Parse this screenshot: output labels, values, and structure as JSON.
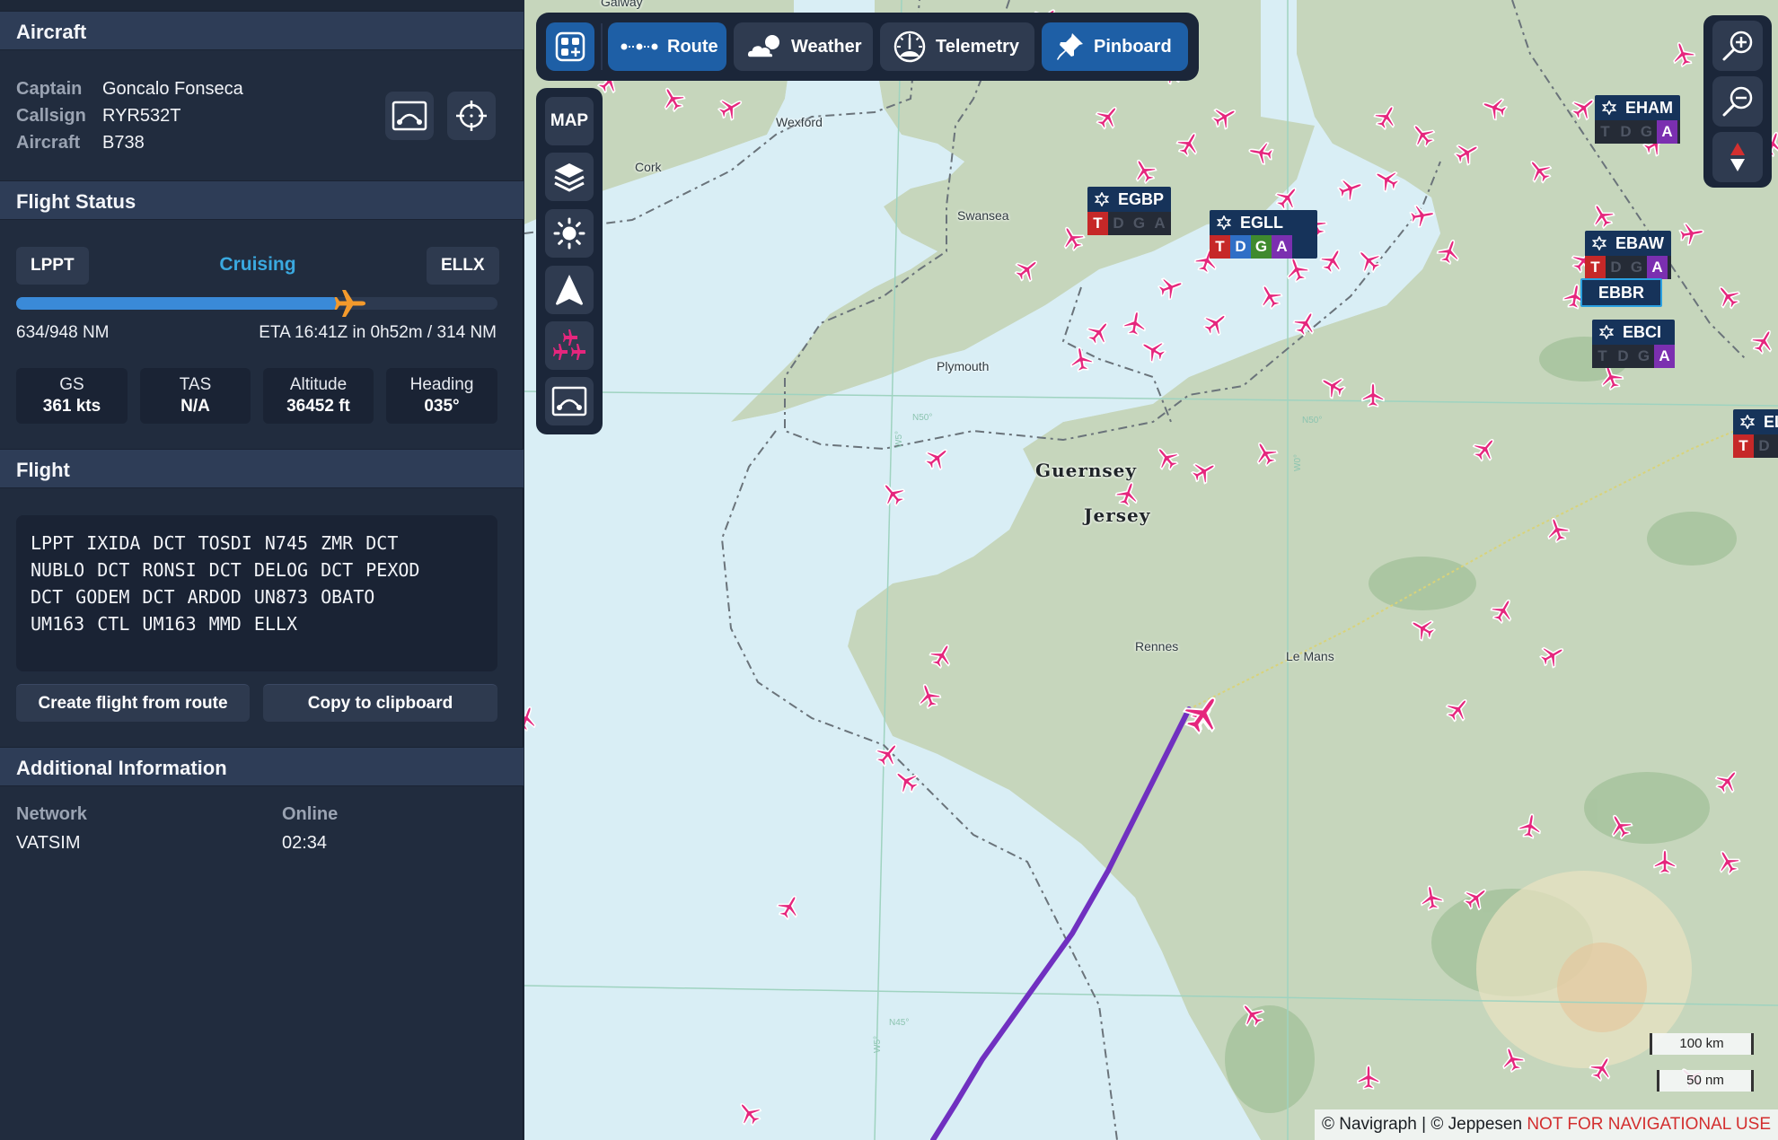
{
  "aircraft_section": {
    "title": "Aircraft",
    "fields": [
      {
        "label": "Captain",
        "value": "Goncalo Fonseca"
      },
      {
        "label": "Callsign",
        "value": "RYR532T"
      },
      {
        "label": "Aircraft",
        "value": "B738"
      }
    ],
    "buttons": [
      {
        "icon": "route-arc-icon"
      },
      {
        "icon": "crosshair-icon"
      }
    ]
  },
  "flight_status": {
    "title": "Flight Status",
    "departure": "LPPT",
    "arrival": "ELLX",
    "phase": "Cruising",
    "progress_fraction": 0.669,
    "distance_flown": "634/948 NM",
    "eta": "ETA 16:41Z in 0h52m / 314 NM",
    "stats": [
      {
        "label": "GS",
        "value": "361 kts"
      },
      {
        "label": "TAS",
        "value": "N/A"
      },
      {
        "label": "Altitude",
        "value": "36452 ft"
      },
      {
        "label": "Heading",
        "value": "035°"
      }
    ]
  },
  "flight": {
    "title": "Flight",
    "route": "LPPT IXIDA DCT TOSDI N745 ZMR DCT\nNUBLO DCT RONSI DCT DELOG DCT PEXOD\nDCT GODEM DCT ARDOD UN873 OBATO\nUM163 CTL UM163 MMD ELLX",
    "create_button": "Create flight from route",
    "copy_button": "Copy to clipboard"
  },
  "additional": {
    "title": "Additional Information",
    "network_label": "Network",
    "network_value": "VATSIM",
    "online_label": "Online",
    "online_value": "02:34"
  },
  "map": {
    "toolbar": [
      {
        "label": "Route",
        "icon": "route-dots-icon",
        "active": true
      },
      {
        "label": "Weather",
        "icon": "cloud-icon",
        "active": false
      },
      {
        "label": "Telemetry",
        "icon": "gauge-icon",
        "active": false
      },
      {
        "label": "Pinboard",
        "icon": "pin-icon",
        "active": true
      }
    ],
    "side_buttons": [
      {
        "label": "MAP",
        "icon": "map-text"
      },
      {
        "icon": "layers-icon"
      },
      {
        "icon": "brightness-icon"
      },
      {
        "icon": "navigation-arrow-icon"
      },
      {
        "icon": "traffic-planes-icon"
      },
      {
        "icon": "route-arc-icon"
      }
    ],
    "airports": [
      {
        "code": "EGBP",
        "letters": [
          "T",
          "D",
          "G",
          "A"
        ],
        "active": [
          "T"
        ]
      },
      {
        "code": "EGLL",
        "letters": [
          "T",
          "D",
          "G",
          "A"
        ],
        "active": [
          "T",
          "D",
          "G",
          "A"
        ]
      },
      {
        "code": "EHAM",
        "letters": [
          "T",
          "D",
          "G",
          "A"
        ],
        "active": [
          "A"
        ]
      },
      {
        "code": "EBAW",
        "letters": [
          "T",
          "D",
          "G",
          "A"
        ],
        "active": [
          "T",
          "A"
        ]
      },
      {
        "code": "EBBR"
      },
      {
        "code": "EBCI",
        "letters": [
          "T",
          "D",
          "G",
          "A"
        ],
        "active": [
          "A"
        ]
      },
      {
        "code": "EL",
        "letters": [
          "T",
          "D"
        ],
        "active": [
          "T"
        ]
      }
    ],
    "labels": {
      "galway": "Galway",
      "wexford": "Wexford",
      "cork": "Cork",
      "swansea": "Swansea",
      "plymouth": "Plymouth",
      "guernsey": "Guernsey",
      "jersey": "Jersey",
      "rennes": "Rennes",
      "le_mans": "Le Mans"
    },
    "grid_labels": {
      "n50_left": "N50°",
      "n50_right": "N50°",
      "n45": "N45°",
      "w5_top": "W5°",
      "w5_bottom": "W5°",
      "w0": "W0°"
    },
    "scale": {
      "km": "100 km",
      "nm": "50 nm"
    },
    "attribution": "© Navigraph | © Jeppesen",
    "warning": "NOT FOR NAVIGATIONAL USE"
  },
  "colors": {
    "accent_blue": "#1e5fa6",
    "status_cyan": "#3aa9e0",
    "progress": "#3a8ad8",
    "plane_orange": "#f39a2c",
    "traffic_pink": "#e5267d",
    "route_purple": "#7030c0",
    "tag_T": "#c62828",
    "tag_D": "#2f6fc6",
    "tag_G": "#3f8a2e",
    "tag_A": "#7b2fb0"
  }
}
